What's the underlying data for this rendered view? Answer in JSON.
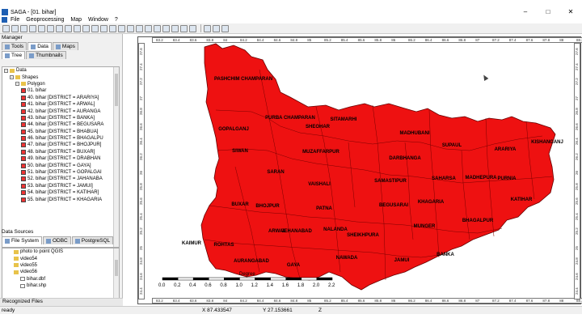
{
  "window": {
    "title": "SAGA - [01. bihar]",
    "buttons": [
      "–",
      "□",
      "✕"
    ]
  },
  "menu": [
    "File",
    "Geoprocessing",
    "Map",
    "Window",
    "?"
  ],
  "manager": {
    "title": "Manager",
    "tabs": [
      "Tools",
      "Data",
      "Maps"
    ],
    "subtabs": [
      "Tree",
      "Thumbnails"
    ],
    "tree": [
      {
        "label": "Data",
        "level": 0
      },
      {
        "label": "Shapes",
        "level": 1
      },
      {
        "label": "Polygon",
        "level": 2
      },
      {
        "label": "01. bihar",
        "level": 3
      },
      {
        "label": "40. bihar [DISTRICT = ARARIYA]",
        "level": 3
      },
      {
        "label": "41. bihar [DISTRICT = ARWAL]",
        "level": 3
      },
      {
        "label": "42. bihar [DISTRICT = AURANGA",
        "level": 3
      },
      {
        "label": "43. bihar [DISTRICT = BANKA]",
        "level": 3
      },
      {
        "label": "44. bihar [DISTRICT = BEGUSARA",
        "level": 3
      },
      {
        "label": "45. bihar [DISTRICT = BHABUA]",
        "level": 3
      },
      {
        "label": "46. bihar [DISTRICT = BHAGALPU",
        "level": 3
      },
      {
        "label": "47. bihar [DISTRICT = BHOJPUR]",
        "level": 3
      },
      {
        "label": "48. bihar [DISTRICT = BUXAR]",
        "level": 3
      },
      {
        "label": "49. bihar [DISTRICT = DRABHAN",
        "level": 3
      },
      {
        "label": "50. bihar [DISTRICT = GAYA]",
        "level": 3
      },
      {
        "label": "51. bihar [DISTRICT = GOPALGAI",
        "level": 3
      },
      {
        "label": "52. bihar [DISTRICT = JAHANABA",
        "level": 3
      },
      {
        "label": "53. bihar [DISTRICT = JAMUI]",
        "level": 3
      },
      {
        "label": "54. bihar [DISTRICT = KATIHAR]",
        "level": 3
      },
      {
        "label": "55. bihar [DISTRICT = KHAGARIA",
        "level": 3
      }
    ]
  },
  "datasources": {
    "title": "Data Sources",
    "tabs": [
      "File System",
      "ODBC",
      "PostgreSQL"
    ],
    "items": [
      {
        "label": "photo to point QGIS",
        "level": 1
      },
      {
        "label": "video54",
        "level": 1
      },
      {
        "label": "video55",
        "level": 1
      },
      {
        "label": "video56",
        "level": 1
      },
      {
        "label": "bihar.dbf",
        "level": 2
      },
      {
        "label": "bihar.shp",
        "level": 2
      }
    ],
    "recognized": "Recognized Files"
  },
  "status": {
    "ready": "ready",
    "x": "X 87.433547",
    "y": "Y 27.153661",
    "z": "Z"
  },
  "map": {
    "fill": "#ee1111",
    "top_ticks": [
      "83.2",
      "83.4",
      "83.6",
      "83.8",
      "84",
      "84.2",
      "84.4",
      "84.6",
      "84.8",
      "85",
      "85.2",
      "85.4",
      "85.6",
      "85.8",
      "86",
      "86.2",
      "86.4",
      "86.6",
      "86.8",
      "87",
      "87.2",
      "87.4",
      "87.6",
      "87.8",
      "88",
      "88.2"
    ],
    "side_ticks": [
      "27.6",
      "27.4",
      "27.2",
      "27",
      "26.8",
      "26.6",
      "26.4",
      "26.2",
      "26",
      "25.8",
      "25.6",
      "25.4",
      "25.2",
      "25",
      "24.8",
      "24.6",
      "24.4"
    ],
    "districts": [
      "PASHCHIM CHAMPARAN",
      "PURBA CHAMPARAN",
      "SITAMARHI",
      "SHEOHAR",
      "MADHUBANI",
      "GOPALGANJ",
      "SUPAUL",
      "ARARIYA",
      "KISHANGANJ",
      "SIWAN",
      "MUZAFFARPUR",
      "DARBHANGA",
      "SARAN",
      "SAHARSA",
      "MADHEPURA",
      "PURNIA",
      "VAISHALI",
      "SAMASTIPUR",
      "KATIHAR",
      "BUXAR",
      "BHOJPUR",
      "PATNA",
      "BEGUSARAI",
      "KHAGARIA",
      "BHAGALPUR",
      "ARWAL",
      "JEHANABAD",
      "NALANDA",
      "SHEIKHPURA",
      "MUNGER",
      "KAIMUR",
      "ROHTAS",
      "AURANGABAD",
      "GAYA",
      "NAWADA",
      "JAMUI",
      "BANKA"
    ],
    "scale": {
      "ticks": [
        "0.0",
        "0.2",
        "0.4",
        "0.6",
        "0.8",
        "1.0",
        "1.2",
        "1.4",
        "1.6",
        "1.8",
        "2.0",
        "2.2"
      ],
      "unit": "Degree"
    }
  }
}
